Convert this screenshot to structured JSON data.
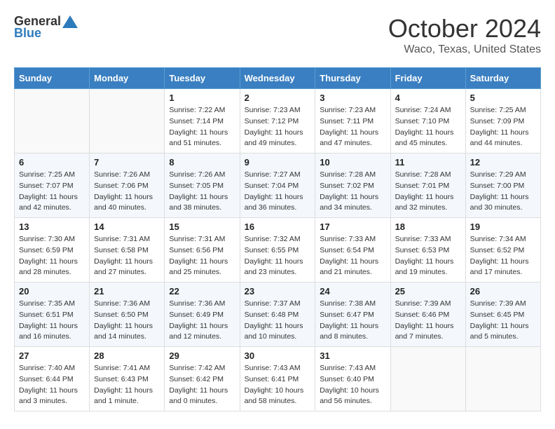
{
  "header": {
    "logo_general": "General",
    "logo_blue": "Blue",
    "month": "October 2024",
    "location": "Waco, Texas, United States"
  },
  "days_of_week": [
    "Sunday",
    "Monday",
    "Tuesday",
    "Wednesday",
    "Thursday",
    "Friday",
    "Saturday"
  ],
  "weeks": [
    [
      {
        "day": "",
        "sunrise": "",
        "sunset": "",
        "daylight": ""
      },
      {
        "day": "",
        "sunrise": "",
        "sunset": "",
        "daylight": ""
      },
      {
        "day": "1",
        "sunrise": "Sunrise: 7:22 AM",
        "sunset": "Sunset: 7:14 PM",
        "daylight": "Daylight: 11 hours and 51 minutes."
      },
      {
        "day": "2",
        "sunrise": "Sunrise: 7:23 AM",
        "sunset": "Sunset: 7:12 PM",
        "daylight": "Daylight: 11 hours and 49 minutes."
      },
      {
        "day": "3",
        "sunrise": "Sunrise: 7:23 AM",
        "sunset": "Sunset: 7:11 PM",
        "daylight": "Daylight: 11 hours and 47 minutes."
      },
      {
        "day": "4",
        "sunrise": "Sunrise: 7:24 AM",
        "sunset": "Sunset: 7:10 PM",
        "daylight": "Daylight: 11 hours and 45 minutes."
      },
      {
        "day": "5",
        "sunrise": "Sunrise: 7:25 AM",
        "sunset": "Sunset: 7:09 PM",
        "daylight": "Daylight: 11 hours and 44 minutes."
      }
    ],
    [
      {
        "day": "6",
        "sunrise": "Sunrise: 7:25 AM",
        "sunset": "Sunset: 7:07 PM",
        "daylight": "Daylight: 11 hours and 42 minutes."
      },
      {
        "day": "7",
        "sunrise": "Sunrise: 7:26 AM",
        "sunset": "Sunset: 7:06 PM",
        "daylight": "Daylight: 11 hours and 40 minutes."
      },
      {
        "day": "8",
        "sunrise": "Sunrise: 7:26 AM",
        "sunset": "Sunset: 7:05 PM",
        "daylight": "Daylight: 11 hours and 38 minutes."
      },
      {
        "day": "9",
        "sunrise": "Sunrise: 7:27 AM",
        "sunset": "Sunset: 7:04 PM",
        "daylight": "Daylight: 11 hours and 36 minutes."
      },
      {
        "day": "10",
        "sunrise": "Sunrise: 7:28 AM",
        "sunset": "Sunset: 7:02 PM",
        "daylight": "Daylight: 11 hours and 34 minutes."
      },
      {
        "day": "11",
        "sunrise": "Sunrise: 7:28 AM",
        "sunset": "Sunset: 7:01 PM",
        "daylight": "Daylight: 11 hours and 32 minutes."
      },
      {
        "day": "12",
        "sunrise": "Sunrise: 7:29 AM",
        "sunset": "Sunset: 7:00 PM",
        "daylight": "Daylight: 11 hours and 30 minutes."
      }
    ],
    [
      {
        "day": "13",
        "sunrise": "Sunrise: 7:30 AM",
        "sunset": "Sunset: 6:59 PM",
        "daylight": "Daylight: 11 hours and 28 minutes."
      },
      {
        "day": "14",
        "sunrise": "Sunrise: 7:31 AM",
        "sunset": "Sunset: 6:58 PM",
        "daylight": "Daylight: 11 hours and 27 minutes."
      },
      {
        "day": "15",
        "sunrise": "Sunrise: 7:31 AM",
        "sunset": "Sunset: 6:56 PM",
        "daylight": "Daylight: 11 hours and 25 minutes."
      },
      {
        "day": "16",
        "sunrise": "Sunrise: 7:32 AM",
        "sunset": "Sunset: 6:55 PM",
        "daylight": "Daylight: 11 hours and 23 minutes."
      },
      {
        "day": "17",
        "sunrise": "Sunrise: 7:33 AM",
        "sunset": "Sunset: 6:54 PM",
        "daylight": "Daylight: 11 hours and 21 minutes."
      },
      {
        "day": "18",
        "sunrise": "Sunrise: 7:33 AM",
        "sunset": "Sunset: 6:53 PM",
        "daylight": "Daylight: 11 hours and 19 minutes."
      },
      {
        "day": "19",
        "sunrise": "Sunrise: 7:34 AM",
        "sunset": "Sunset: 6:52 PM",
        "daylight": "Daylight: 11 hours and 17 minutes."
      }
    ],
    [
      {
        "day": "20",
        "sunrise": "Sunrise: 7:35 AM",
        "sunset": "Sunset: 6:51 PM",
        "daylight": "Daylight: 11 hours and 16 minutes."
      },
      {
        "day": "21",
        "sunrise": "Sunrise: 7:36 AM",
        "sunset": "Sunset: 6:50 PM",
        "daylight": "Daylight: 11 hours and 14 minutes."
      },
      {
        "day": "22",
        "sunrise": "Sunrise: 7:36 AM",
        "sunset": "Sunset: 6:49 PM",
        "daylight": "Daylight: 11 hours and 12 minutes."
      },
      {
        "day": "23",
        "sunrise": "Sunrise: 7:37 AM",
        "sunset": "Sunset: 6:48 PM",
        "daylight": "Daylight: 11 hours and 10 minutes."
      },
      {
        "day": "24",
        "sunrise": "Sunrise: 7:38 AM",
        "sunset": "Sunset: 6:47 PM",
        "daylight": "Daylight: 11 hours and 8 minutes."
      },
      {
        "day": "25",
        "sunrise": "Sunrise: 7:39 AM",
        "sunset": "Sunset: 6:46 PM",
        "daylight": "Daylight: 11 hours and 7 minutes."
      },
      {
        "day": "26",
        "sunrise": "Sunrise: 7:39 AM",
        "sunset": "Sunset: 6:45 PM",
        "daylight": "Daylight: 11 hours and 5 minutes."
      }
    ],
    [
      {
        "day": "27",
        "sunrise": "Sunrise: 7:40 AM",
        "sunset": "Sunset: 6:44 PM",
        "daylight": "Daylight: 11 hours and 3 minutes."
      },
      {
        "day": "28",
        "sunrise": "Sunrise: 7:41 AM",
        "sunset": "Sunset: 6:43 PM",
        "daylight": "Daylight: 11 hours and 1 minute."
      },
      {
        "day": "29",
        "sunrise": "Sunrise: 7:42 AM",
        "sunset": "Sunset: 6:42 PM",
        "daylight": "Daylight: 11 hours and 0 minutes."
      },
      {
        "day": "30",
        "sunrise": "Sunrise: 7:43 AM",
        "sunset": "Sunset: 6:41 PM",
        "daylight": "Daylight: 10 hours and 58 minutes."
      },
      {
        "day": "31",
        "sunrise": "Sunrise: 7:43 AM",
        "sunset": "Sunset: 6:40 PM",
        "daylight": "Daylight: 10 hours and 56 minutes."
      },
      {
        "day": "",
        "sunrise": "",
        "sunset": "",
        "daylight": ""
      },
      {
        "day": "",
        "sunrise": "",
        "sunset": "",
        "daylight": ""
      }
    ]
  ]
}
